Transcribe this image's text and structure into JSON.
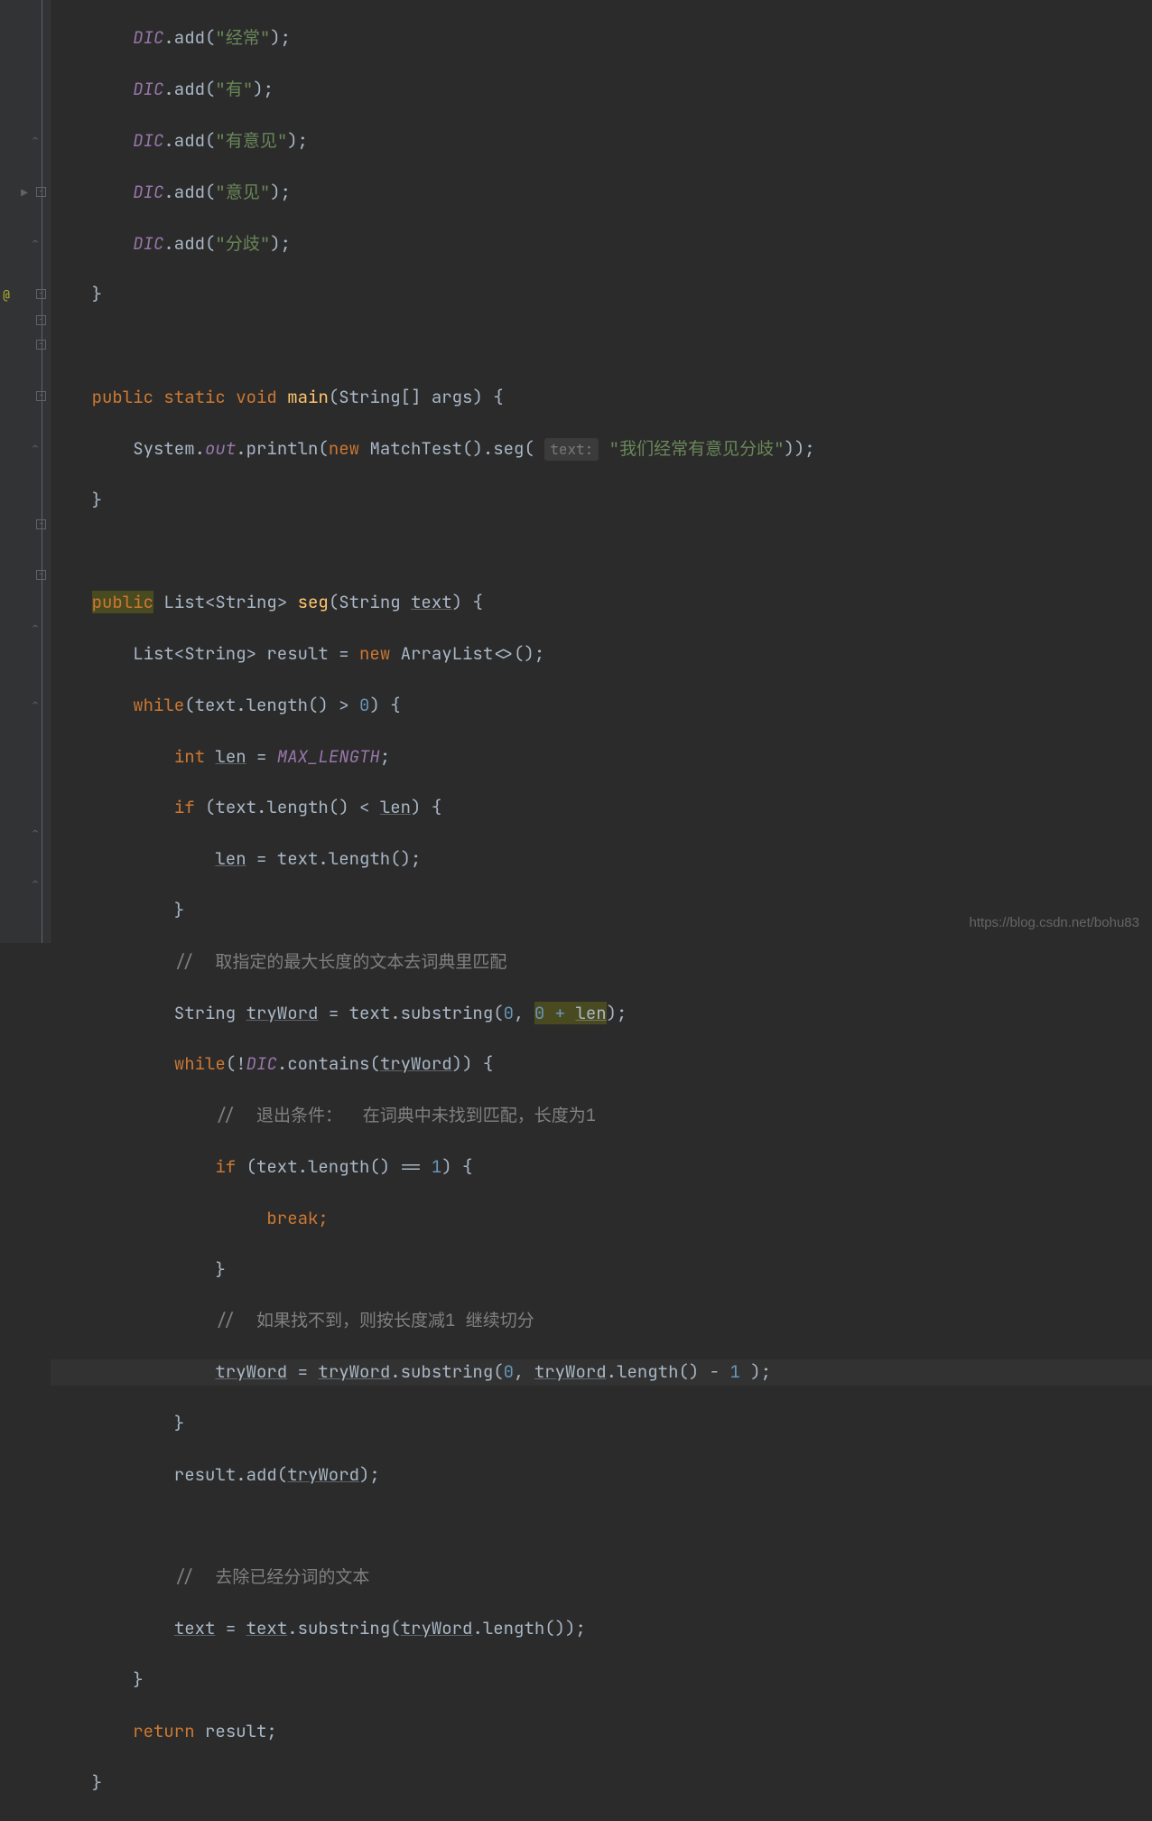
{
  "code": {
    "l0": {
      "p": "        ",
      "a": "DIC",
      "b": ".add(",
      "s": "\"经常\"",
      "c": ");"
    },
    "l1": {
      "p": "        ",
      "a": "DIC",
      "b": ".add(",
      "s": "\"有\"",
      "c": ");"
    },
    "l2": {
      "p": "        ",
      "a": "DIC",
      "b": ".add(",
      "s": "\"有意见\"",
      "c": ");"
    },
    "l3": {
      "p": "        ",
      "a": "DIC",
      "b": ".add(",
      "s": "\"意见\"",
      "c": ");"
    },
    "l4": {
      "p": "        ",
      "a": "DIC",
      "b": ".add(",
      "s": "\"分歧\"",
      "c": ");"
    },
    "l5": {
      "p": "    }",
      "a": "",
      "b": "",
      "s": "",
      "c": ""
    },
    "l6": {
      "p": "",
      "a": "",
      "b": "",
      "s": "",
      "c": ""
    },
    "main_sig_pre": "    ",
    "main_kw1": "public ",
    "main_kw2": "static ",
    "main_kw3": "void ",
    "main_name": "main",
    "main_args": "(String[] args) {",
    "print_pre": "        System.",
    "print_out": "out",
    "print_dot": ".println(",
    "print_new": "new ",
    "print_cls": "MatchTest().seg( ",
    "print_hint": "text:",
    "print_sp": " ",
    "print_str": "\"我们经常有意见分歧\"",
    "print_end": "));",
    "close1": "    }",
    "blank": "",
    "seg_pre": "    ",
    "seg_public": "public",
    "seg_sig_a": " List<String> ",
    "seg_name": "seg",
    "seg_sig_b": "(String ",
    "seg_param": "text",
    "seg_sig_c": ") {",
    "result_pre": "        List<String> result = ",
    "result_new": "new ",
    "result_cls": "ArrayList<>();",
    "while1_pre": "        ",
    "while1_kw": "while",
    "while1_a": "(text.length() > ",
    "while1_n": "0",
    "while1_b": ") {",
    "len_pre": "            ",
    "len_kw": "int ",
    "len_var": "len",
    "len_eq": " = ",
    "len_const": "MAX_LENGTH",
    "len_semi": ";",
    "if1_pre": "            ",
    "if1_kw": "if ",
    "if1_a": "(text.length() < ",
    "if1_var": "len",
    "if1_b": ") {",
    "lenassign_pre": "                ",
    "lenassign_var": "len",
    "lenassign_rest": " = text.length();",
    "close2": "            }",
    "cmt1_pre": "            ",
    "cmt1": "//  取指定的最大长度的文本去词典里匹配",
    "tryw_pre": "            String ",
    "tryw_var": "tryWord",
    "tryw_eq": " = text.substring(",
    "tryw_n0": "0",
    "tryw_c": ", ",
    "tryw_expr_a": "0 + ",
    "tryw_expr_b": "len",
    "tryw_end": ");",
    "while2_pre": "            ",
    "while2_kw": "while",
    "while2_a": "(!",
    "while2_dic": "DIC",
    "while2_b": ".contains(",
    "while2_var": "tryWord",
    "while2_c": ")) {",
    "cmt2_pre": "                ",
    "cmt2": "//  退出条件：  在词典中未找到匹配，长度为1",
    "if2_pre": "                ",
    "if2_kw": "if ",
    "if2_a": "(text.length() == ",
    "if2_n": "1",
    "if2_b": ") {",
    "break_pre": "                     ",
    "break_kw": "break;",
    "close3": "                }",
    "cmt3_pre": "                ",
    "cmt3": "//  如果找不到，则按长度减1 继续切分",
    "sub_pre": "                ",
    "sub_v1": "tryWord",
    "sub_eq": " = ",
    "sub_v2": "tryWord",
    "sub_a": ".substring(",
    "sub_n0": "0",
    "sub_c": ", ",
    "sub_v3": "tryWord",
    "sub_b": ".length() - ",
    "sub_n1": "1",
    "sub_end": " );",
    "close4": "            }",
    "add_pre": "            result.add(",
    "add_var": "tryWord",
    "add_end": ");",
    "cmt4_pre": "            ",
    "cmt4": "//  去除已经分词的文本",
    "txt_pre": "            ",
    "txt_v1": "text",
    "txt_eq": " = ",
    "txt_v2": "text",
    "txt_a": ".substring(",
    "txt_v3": "tryWord",
    "txt_b": ".length());",
    "close5": "        }",
    "ret_pre": "        ",
    "ret_kw": "return ",
    "ret_v": "result;",
    "close6": "    }"
  },
  "watermark": "https://blog.csdn.net/bohu83"
}
